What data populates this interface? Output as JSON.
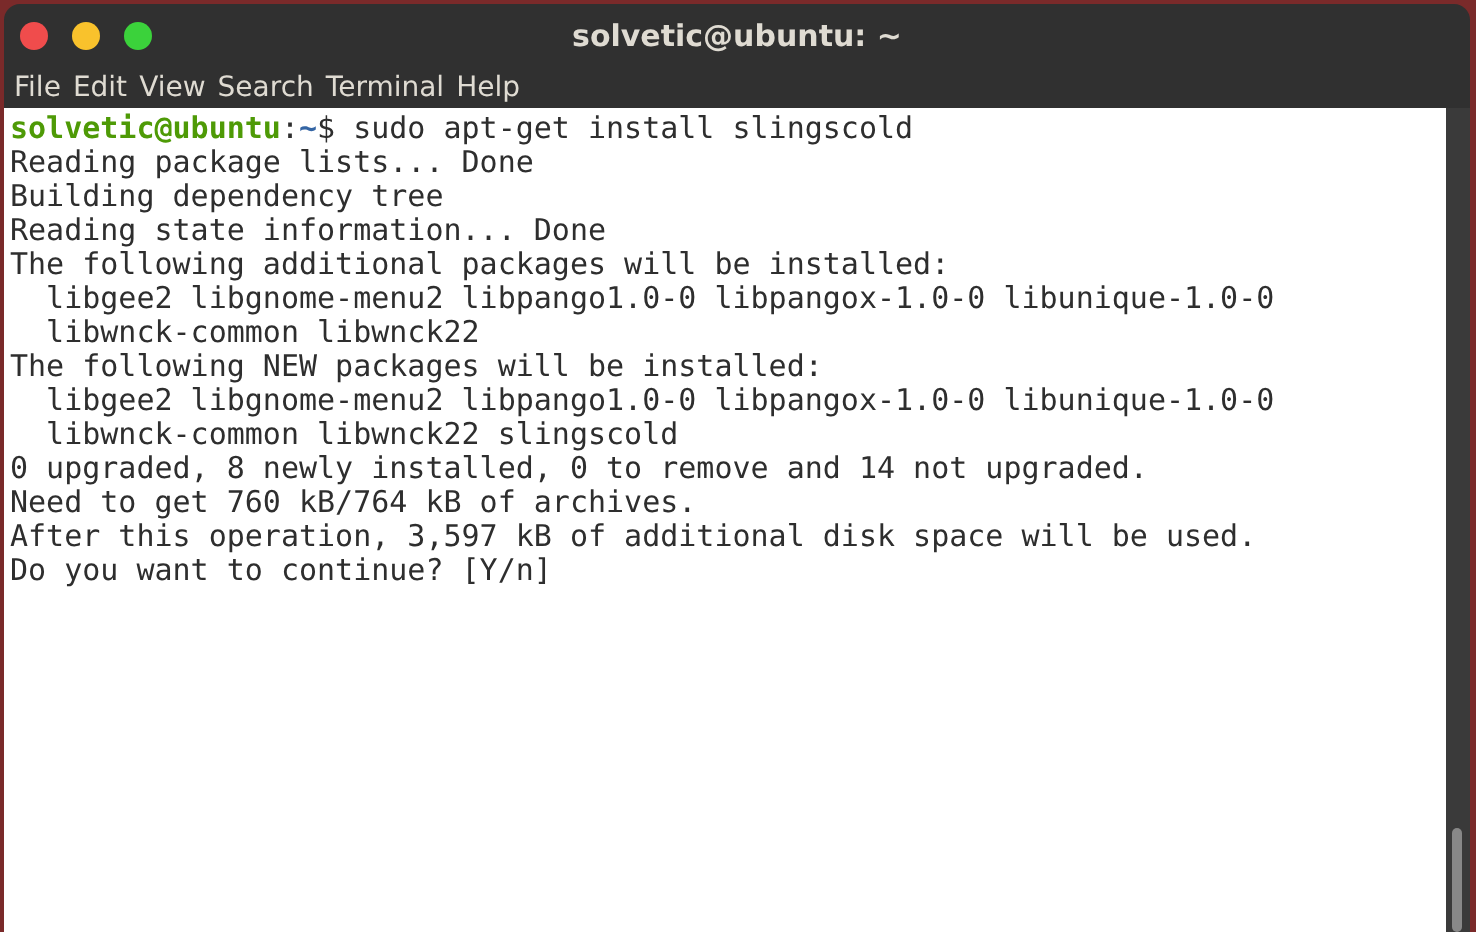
{
  "window": {
    "title": "solvetic@ubuntu: ~"
  },
  "menu": [
    "File",
    "Edit",
    "View",
    "Search",
    "Terminal",
    "Help"
  ],
  "terminal": {
    "prompt": {
      "user_host": "solvetic@ubuntu",
      "separator": ":",
      "path": "~",
      "symbol": "$",
      "command": "sudo apt-get install slingscold"
    },
    "output": [
      "Reading package lists... Done",
      "Building dependency tree",
      "Reading state information... Done",
      "The following additional packages will be installed:",
      "  libgee2 libgnome-menu2 libpango1.0-0 libpangox-1.0-0 libunique-1.0-0",
      "  libwnck-common libwnck22",
      "The following NEW packages will be installed:",
      "  libgee2 libgnome-menu2 libpango1.0-0 libpangox-1.0-0 libunique-1.0-0",
      "  libwnck-common libwnck22 slingscold",
      "0 upgraded, 8 newly installed, 0 to remove and 14 not upgraded.",
      "Need to get 760 kB/764 kB of archives.",
      "After this operation, 3,597 kB of additional disk space will be used.",
      "Do you want to continue? [Y/n]"
    ]
  }
}
